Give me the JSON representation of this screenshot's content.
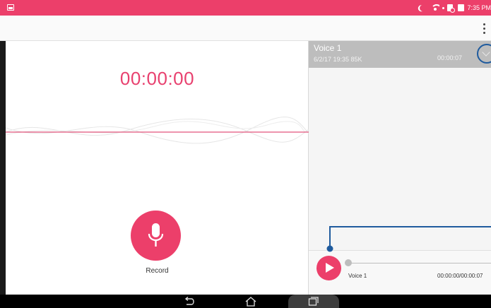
{
  "status_bar": {
    "time": "7:35 PM",
    "accent_color": "#ec3f6a"
  },
  "recorder": {
    "timer": "00:00:00",
    "record_label": "Record",
    "accent_color": "#e8416f"
  },
  "recordings": [
    {
      "title": "Voice 1",
      "meta": "6/2/17 19:35  85K",
      "duration": "00:00:07"
    }
  ],
  "player": {
    "title": "Voice 1",
    "time": "00:00:00/00:00:07",
    "progress": 0
  },
  "icons": {
    "overflow": "more-vert-icon",
    "record": "mic-icon",
    "play": "play-icon",
    "expand": "chevron-down-icon",
    "back": "back-icon",
    "home": "home-icon",
    "recents": "recents-icon"
  }
}
